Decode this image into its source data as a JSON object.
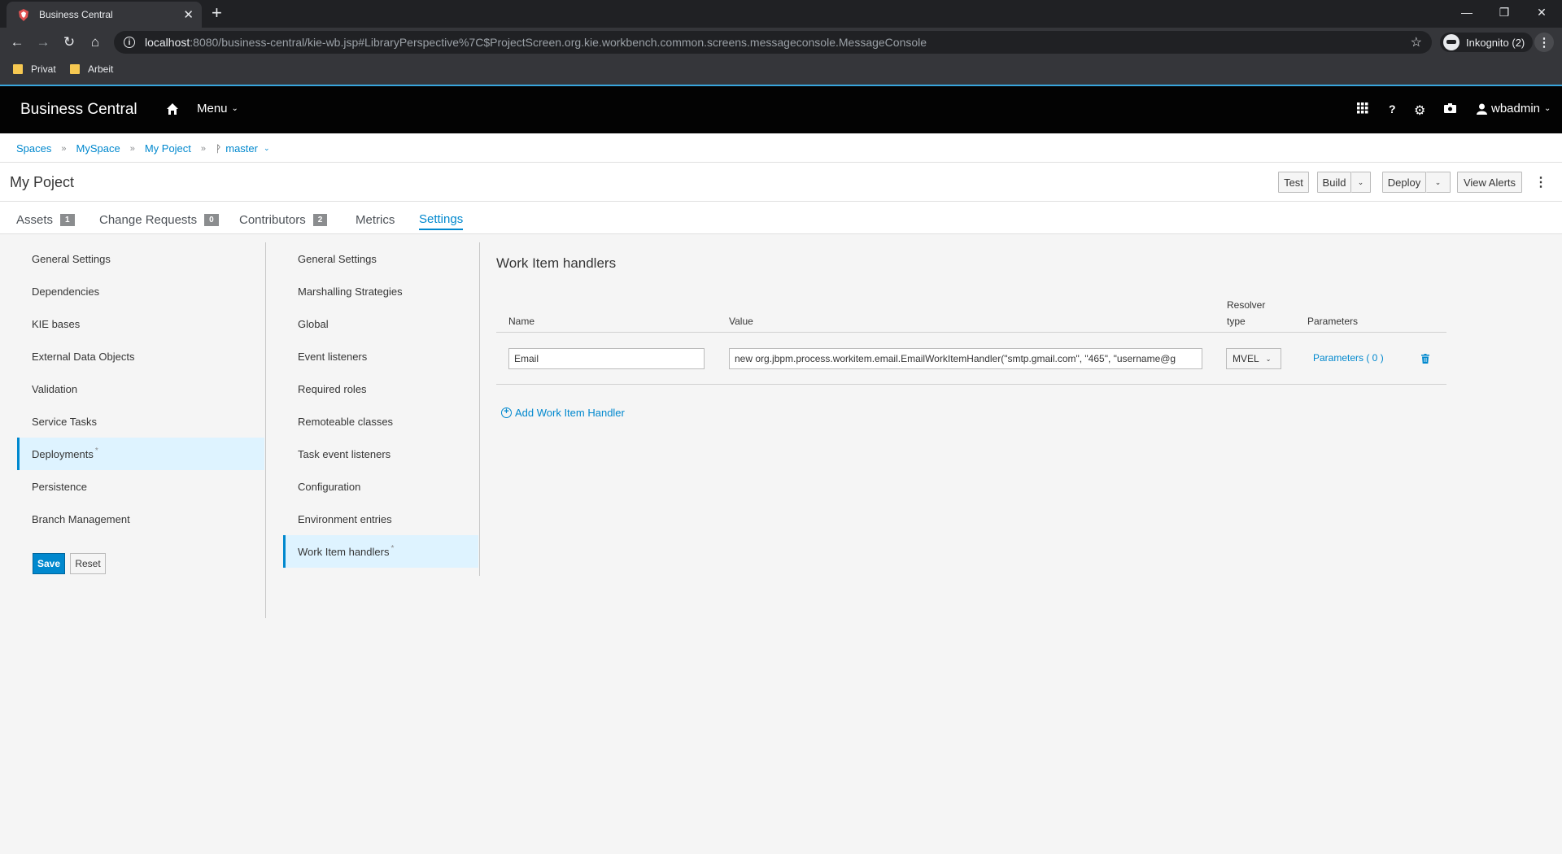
{
  "browser": {
    "tab_title": "Business Central",
    "url_host": "localhost",
    "url_rest": ":8080/business-central/kie-wb.jsp#LibraryPerspective%7C$ProjectScreen.org.kie.workbench.common.screens.messageconsole.MessageConsole",
    "incognito_label": "Inkognito (2)",
    "bookmarks": [
      "Privat",
      "Arbeit"
    ]
  },
  "header": {
    "brand": "Business Central",
    "menu_label": "Menu",
    "username": "wbadmin",
    "help_label": "?"
  },
  "breadcrumb": {
    "items": [
      "Spaces",
      "MySpace",
      "My Poject"
    ],
    "branch": "master"
  },
  "project": {
    "title": "My Poject",
    "buttons": {
      "test": "Test",
      "build": "Build",
      "deploy": "Deploy",
      "view_alerts": "View Alerts"
    },
    "tabs": [
      {
        "label": "Assets",
        "badge": "1"
      },
      {
        "label": "Change Requests",
        "badge": "0"
      },
      {
        "label": "Contributors",
        "badge": "2"
      },
      {
        "label": "Metrics"
      },
      {
        "label": "Settings",
        "active": true
      }
    ]
  },
  "settings_nav": {
    "items": [
      {
        "label": "General Settings"
      },
      {
        "label": "Dependencies"
      },
      {
        "label": "KIE bases"
      },
      {
        "label": "External Data Objects"
      },
      {
        "label": "Validation"
      },
      {
        "label": "Service Tasks"
      },
      {
        "label": "Deployments",
        "active": true,
        "modified": "*"
      },
      {
        "label": "Persistence"
      },
      {
        "label": "Branch Management"
      }
    ],
    "save_label": "Save",
    "reset_label": "Reset"
  },
  "deployments_nav": {
    "items": [
      {
        "label": "General Settings"
      },
      {
        "label": "Marshalling Strategies"
      },
      {
        "label": "Global"
      },
      {
        "label": "Event listeners"
      },
      {
        "label": "Required roles"
      },
      {
        "label": "Remoteable classes"
      },
      {
        "label": "Task event listeners"
      },
      {
        "label": "Configuration"
      },
      {
        "label": "Environment entries"
      },
      {
        "label": "Work Item handlers",
        "active": true,
        "modified": "*"
      }
    ]
  },
  "work_item_handlers": {
    "title": "Work Item handlers",
    "columns": {
      "name": "Name",
      "value": "Value",
      "resolver_line1": "Resolver",
      "resolver_line2": "type",
      "parameters": "Parameters"
    },
    "rows": [
      {
        "name": "Email",
        "value": "new org.jbpm.process.workitem.email.EmailWorkItemHandler(\"smtp.gmail.com\", \"465\", \"username@g",
        "resolver": "MVEL",
        "parameters_link": "Parameters ( 0 )"
      }
    ],
    "add_label": "Add Work Item Handler"
  },
  "colors": {
    "accent": "#0088ce",
    "header_bg": "#030303",
    "active_bg": "#def3ff"
  }
}
